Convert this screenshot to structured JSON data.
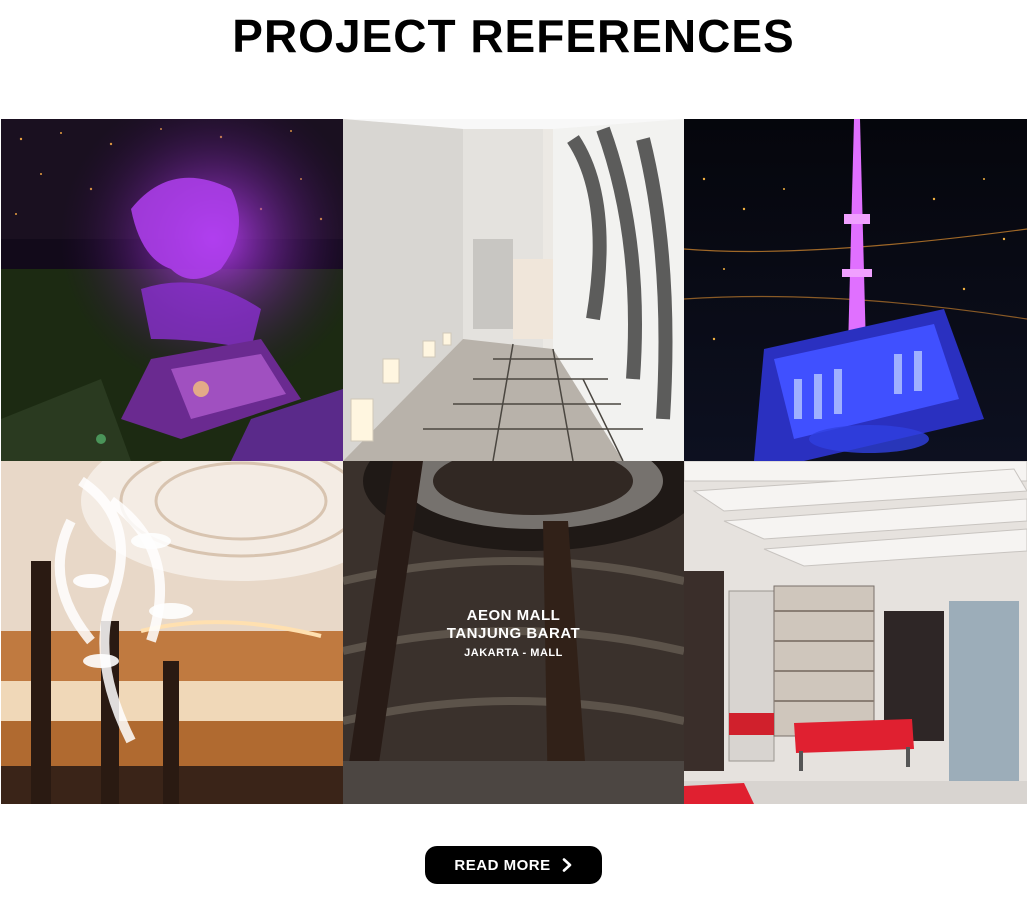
{
  "page": {
    "title": "PROJECT REFERENCES"
  },
  "projects": [
    {
      "image": "garuda-statue-night-aerial"
    },
    {
      "image": "minimalist-corridor-with-lanterns"
    },
    {
      "image": "illuminated-tower-night"
    },
    {
      "image": "hotel-atrium-leaf-sculpture"
    },
    {
      "image": "mall-atrium-interior",
      "name_line1": "AEON MALL",
      "name_line2": "TANJUNG BARAT",
      "category": "JAKARTA - MALL"
    },
    {
      "image": "sneaker-store-interior"
    }
  ],
  "cta": {
    "label": "READ MORE",
    "icon": "chevron-right-icon"
  },
  "colors": {
    "button_bg": "#000000",
    "button_text": "#ffffff",
    "title": "#000000"
  }
}
